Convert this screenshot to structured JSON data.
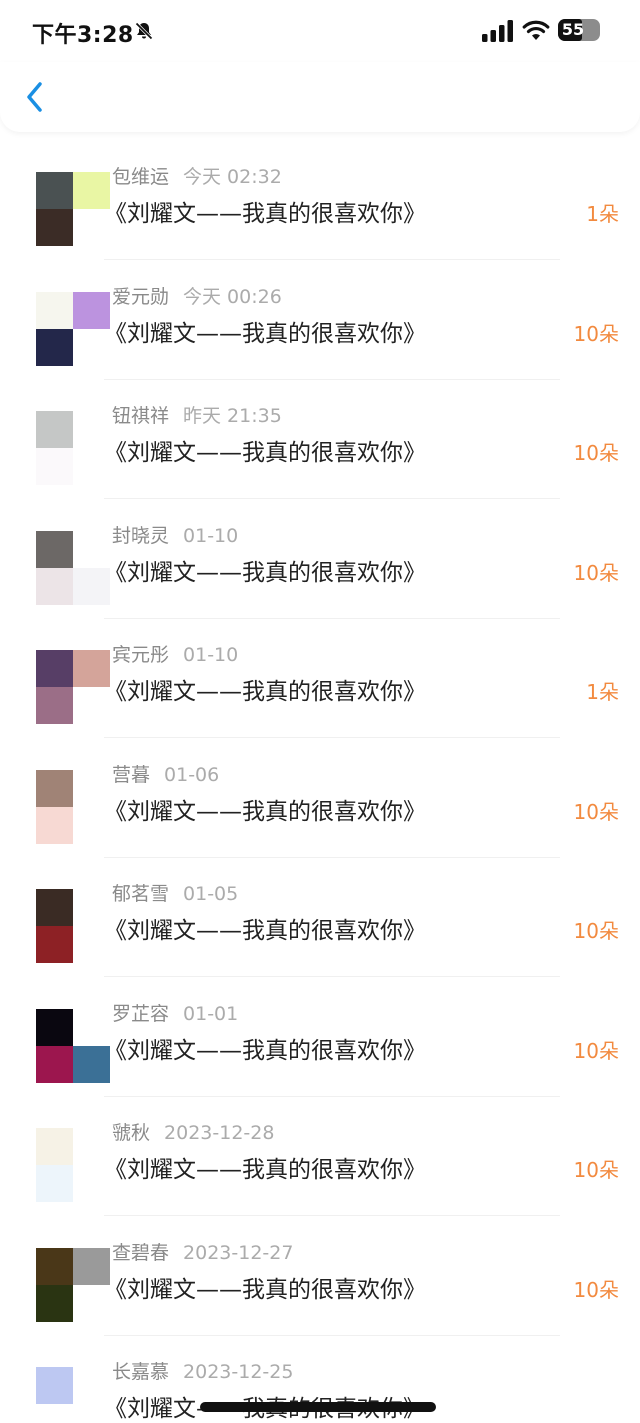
{
  "status_bar": {
    "time": "下午3:28",
    "battery": "55"
  },
  "nav": {
    "back_icon": "chevron-left-icon",
    "accent_color": "#1a8fe3"
  },
  "items": [
    {
      "sender": "包维运",
      "time": "今天 02:32",
      "title": "《刘耀文——我真的很喜欢你》",
      "count": "1朵",
      "colors": [
        "#4a5152",
        "#e9f6a4",
        "#3b2c26",
        "#ffffff"
      ]
    },
    {
      "sender": "爱元勋",
      "time": "今天 00:26",
      "title": "《刘耀文——我真的很喜欢你》",
      "count": "10朵",
      "colors": [
        "#f6f6ee",
        "#bc93df",
        "#23274a",
        "#ffffff"
      ]
    },
    {
      "sender": "钮祺祥",
      "time": "昨天 21:35",
      "title": "《刘耀文——我真的很喜欢你》",
      "count": "10朵",
      "colors": [
        "#c5c7c6",
        "#ffffff",
        "#fbf9fb",
        "#ffffff"
      ]
    },
    {
      "sender": "封晓灵",
      "time": "01-10",
      "title": "《刘耀文——我真的很喜欢你》",
      "count": "10朵",
      "colors": [
        "#6c6866",
        "#ffffff",
        "#ece4e7",
        "#f4f4f7"
      ]
    },
    {
      "sender": "宾元彤",
      "time": "01-10",
      "title": "《刘耀文——我真的很喜欢你》",
      "count": "1朵",
      "colors": [
        "#573e66",
        "#d4a49a",
        "#9b6e87",
        "#ffffff"
      ]
    },
    {
      "sender": "营暮",
      "time": "01-06",
      "title": "《刘耀文——我真的很喜欢你》",
      "count": "10朵",
      "colors": [
        "#a08376",
        "#ffffff",
        "#f7d9d3",
        "#ffffff"
      ]
    },
    {
      "sender": "郁茗雪",
      "time": "01-05",
      "title": "《刘耀文——我真的很喜欢你》",
      "count": "10朵",
      "colors": [
        "#3a2b24",
        "#ffffff",
        "#8d2125",
        "#ffffff"
      ]
    },
    {
      "sender": "罗芷容",
      "time": "01-01",
      "title": "《刘耀文——我真的很喜欢你》",
      "count": "10朵",
      "colors": [
        "#0a0710",
        "#ffffff",
        "#9c164e",
        "#3b7096"
      ]
    },
    {
      "sender": "虢秋",
      "time": "2023-12-28",
      "title": "《刘耀文——我真的很喜欢你》",
      "count": "10朵",
      "colors": [
        "#f6f2e6",
        "#ffffff",
        "#edf5fb",
        "#ffffff"
      ]
    },
    {
      "sender": "查碧春",
      "time": "2023-12-27",
      "title": "《刘耀文——我真的很喜欢你》",
      "count": "10朵",
      "colors": [
        "#4a3718",
        "#9a9a9a",
        "#2a3412",
        "#ffffff"
      ]
    },
    {
      "sender": "长嘉慕",
      "time": "2023-12-25",
      "title": "《刘耀文——我真的很喜欢你》",
      "count": "",
      "colors": [
        "#bdc8f2",
        "#ffffff",
        "#ffffff",
        "#ffffff"
      ]
    }
  ]
}
